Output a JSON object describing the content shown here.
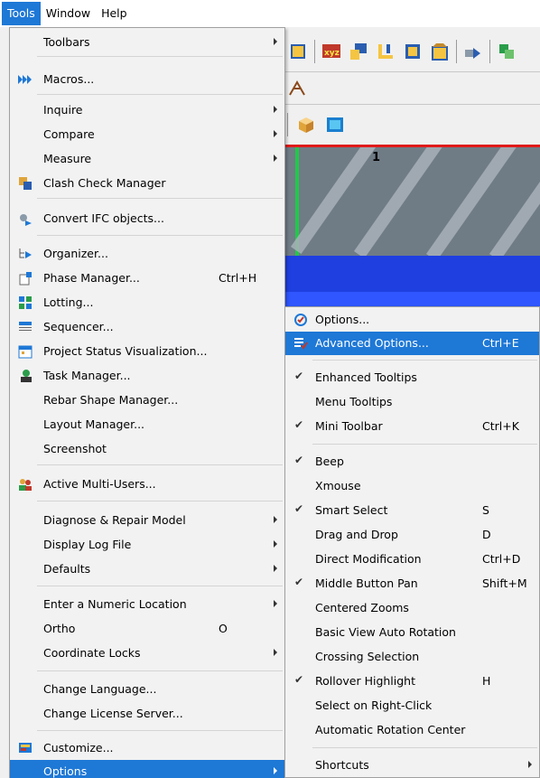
{
  "menubar": {
    "items": [
      {
        "label": "Tools",
        "active": true
      },
      {
        "label": "Window",
        "active": false
      },
      {
        "label": "Help",
        "active": false
      }
    ]
  },
  "viewport": {
    "grid_label": "1"
  },
  "toolbar": {
    "xyz_label": "xyz"
  },
  "tools_menu": {
    "toolbars": "Toolbars",
    "macros": "Macros...",
    "inquire": "Inquire",
    "compare": "Compare",
    "measure": "Measure",
    "clash_check_manager": "Clash Check Manager",
    "convert_ifc": "Convert IFC objects...",
    "organizer": "Organizer...",
    "phase_manager": "Phase Manager...",
    "phase_manager_shortcut": "Ctrl+H",
    "lotting": "Lotting...",
    "sequencer": "Sequencer...",
    "project_status": "Project Status Visualization...",
    "task_manager": "Task Manager...",
    "rebar_shape_manager": "Rebar Shape Manager...",
    "layout_manager": "Layout Manager...",
    "screenshot": "Screenshot",
    "active_multi_users": "Active Multi-Users...",
    "diagnose_repair": "Diagnose & Repair Model",
    "display_log_file": "Display Log File",
    "defaults": "Defaults",
    "enter_numeric_location": "Enter a Numeric Location",
    "ortho": "Ortho",
    "ortho_shortcut": "O",
    "coordinate_locks": "Coordinate Locks",
    "change_language": "Change Language...",
    "change_license_server": "Change License Server...",
    "customize": "Customize...",
    "options": "Options"
  },
  "options_menu": {
    "options": "Options...",
    "advanced_options": "Advanced Options...",
    "advanced_options_shortcut": "Ctrl+E",
    "enhanced_tooltips": "Enhanced Tooltips",
    "menu_tooltips": "Menu Tooltips",
    "mini_toolbar": "Mini Toolbar",
    "mini_toolbar_shortcut": "Ctrl+K",
    "beep": "Beep",
    "xmouse": "Xmouse",
    "smart_select": "Smart Select",
    "smart_select_shortcut": "S",
    "drag_and_drop": "Drag and Drop",
    "drag_and_drop_shortcut": "D",
    "direct_modification": "Direct Modification",
    "direct_modification_shortcut": "Ctrl+D",
    "middle_button_pan": "Middle Button Pan",
    "middle_button_pan_shortcut": "Shift+M",
    "centered_zooms": "Centered Zooms",
    "basic_view_auto_rotation": "Basic View Auto Rotation",
    "crossing_selection": "Crossing Selection",
    "rollover_highlight": "Rollover Highlight",
    "rollover_highlight_shortcut": "H",
    "select_on_right_click": "Select on Right-Click",
    "automatic_rotation_center": "Automatic Rotation Center",
    "shortcuts": "Shortcuts",
    "checked": {
      "enhanced_tooltips": true,
      "menu_tooltips": false,
      "mini_toolbar": true,
      "beep": true,
      "xmouse": false,
      "smart_select": true,
      "drag_and_drop": false,
      "direct_modification": false,
      "middle_button_pan": true,
      "centered_zooms": false,
      "basic_view_auto_rotation": false,
      "crossing_selection": false,
      "rollover_highlight": true,
      "select_on_right_click": false,
      "automatic_rotation_center": false
    }
  },
  "colors": {
    "highlight": "#1e78d6",
    "menu_bg": "#f2f2f2",
    "viewport_red_line": "#e01b1b",
    "viewport_blue": "#1f3fe0"
  }
}
